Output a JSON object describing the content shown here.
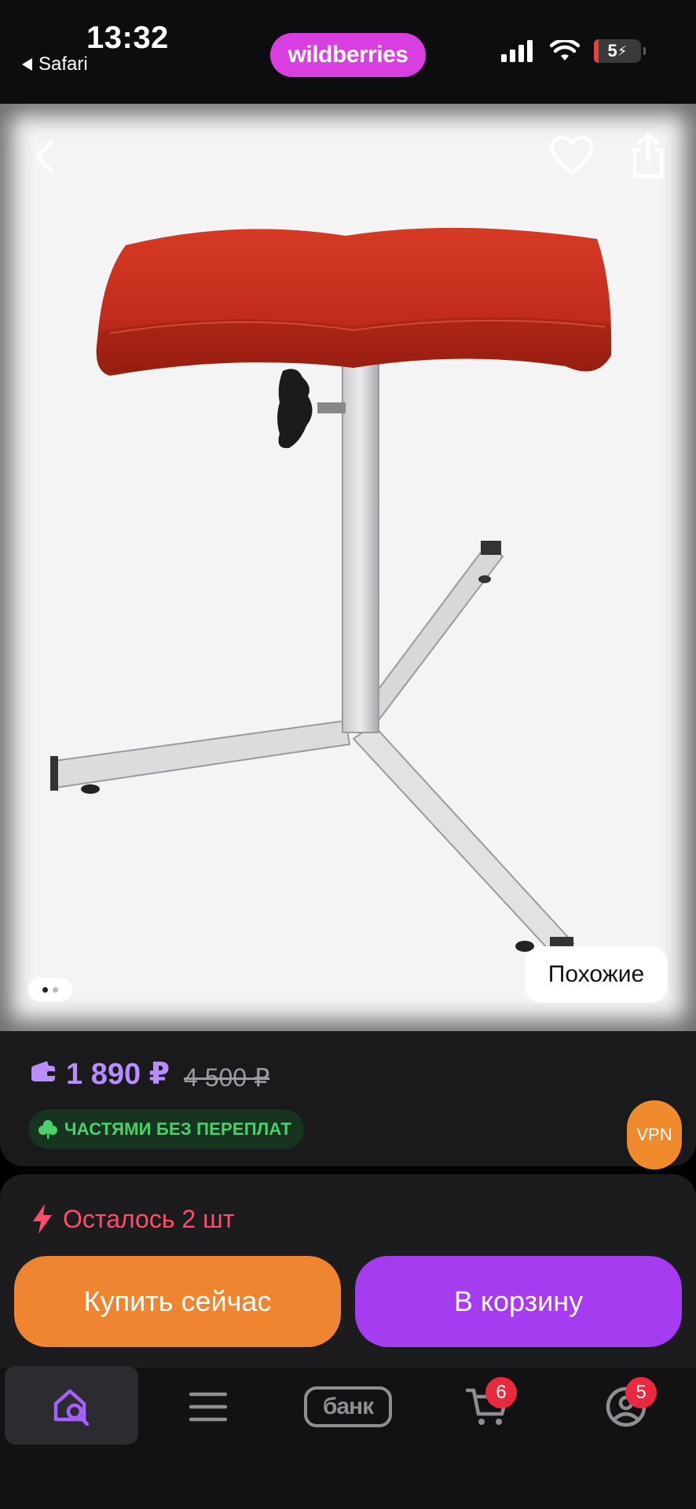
{
  "status_bar": {
    "time": "13:32",
    "back_app": "Safari",
    "battery": "5",
    "icons": [
      "signal-icon",
      "wifi-icon",
      "battery-icon"
    ]
  },
  "brand": {
    "name": "wildberries",
    "color": "#d93ee0"
  },
  "gallery": {
    "similar_label": "Похожие",
    "page_count": 2,
    "active_page": 1,
    "icons": [
      "back-icon",
      "heart-icon",
      "share-icon"
    ]
  },
  "price": {
    "current": "1 890 ₽",
    "old": "4 500 ₽",
    "color": "#b98cff",
    "installments_label": "ЧАСТЯМИ БЕЗ ПЕРЕПЛАТ"
  },
  "vpn_label": "VPN",
  "stock": {
    "text": "Осталось 2 шт",
    "color": "#ff4d6a"
  },
  "actions": {
    "buy_now": "Купить сейчас",
    "buy_now_color": "#ef8531",
    "to_cart": "В корзину",
    "to_cart_color": "#a63cf0"
  },
  "tab_bar": {
    "items": [
      {
        "name": "home-search",
        "icon": "home-search-icon",
        "active": true
      },
      {
        "name": "menu",
        "icon": "menu-icon",
        "active": false
      },
      {
        "name": "bank",
        "label": "банк",
        "active": false
      },
      {
        "name": "cart",
        "icon": "cart-icon",
        "badge": "6",
        "active": false
      },
      {
        "name": "profile",
        "icon": "profile-icon",
        "badge": "5",
        "active": false
      }
    ]
  }
}
